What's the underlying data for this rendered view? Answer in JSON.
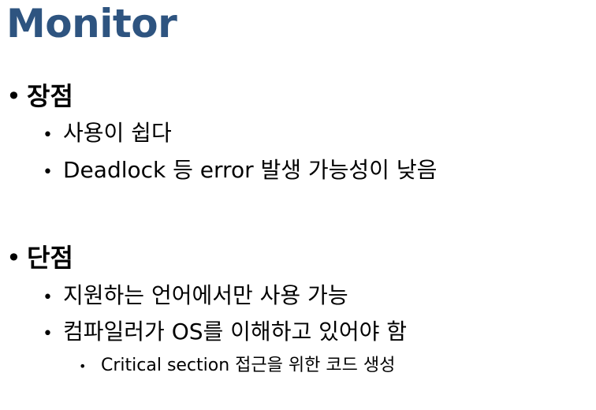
{
  "title": "Monitor",
  "sections": [
    {
      "heading": "장점",
      "items": [
        {
          "text": "사용이 쉽다"
        },
        {
          "text": "Deadlock 등 error 발생 가능성이 낮음"
        }
      ]
    },
    {
      "heading": "단점",
      "items": [
        {
          "text": "지원하는 언어에서만 사용 가능"
        },
        {
          "text": "컴파일러가 OS를 이해하고 있어야 함",
          "subitems": [
            {
              "text": "Critical section 접근을 위한 코드 생성"
            }
          ]
        }
      ]
    }
  ],
  "bullet_glyph": "•",
  "colors": {
    "title": "#2e5480",
    "text": "#000000",
    "background": "#ffffff"
  }
}
